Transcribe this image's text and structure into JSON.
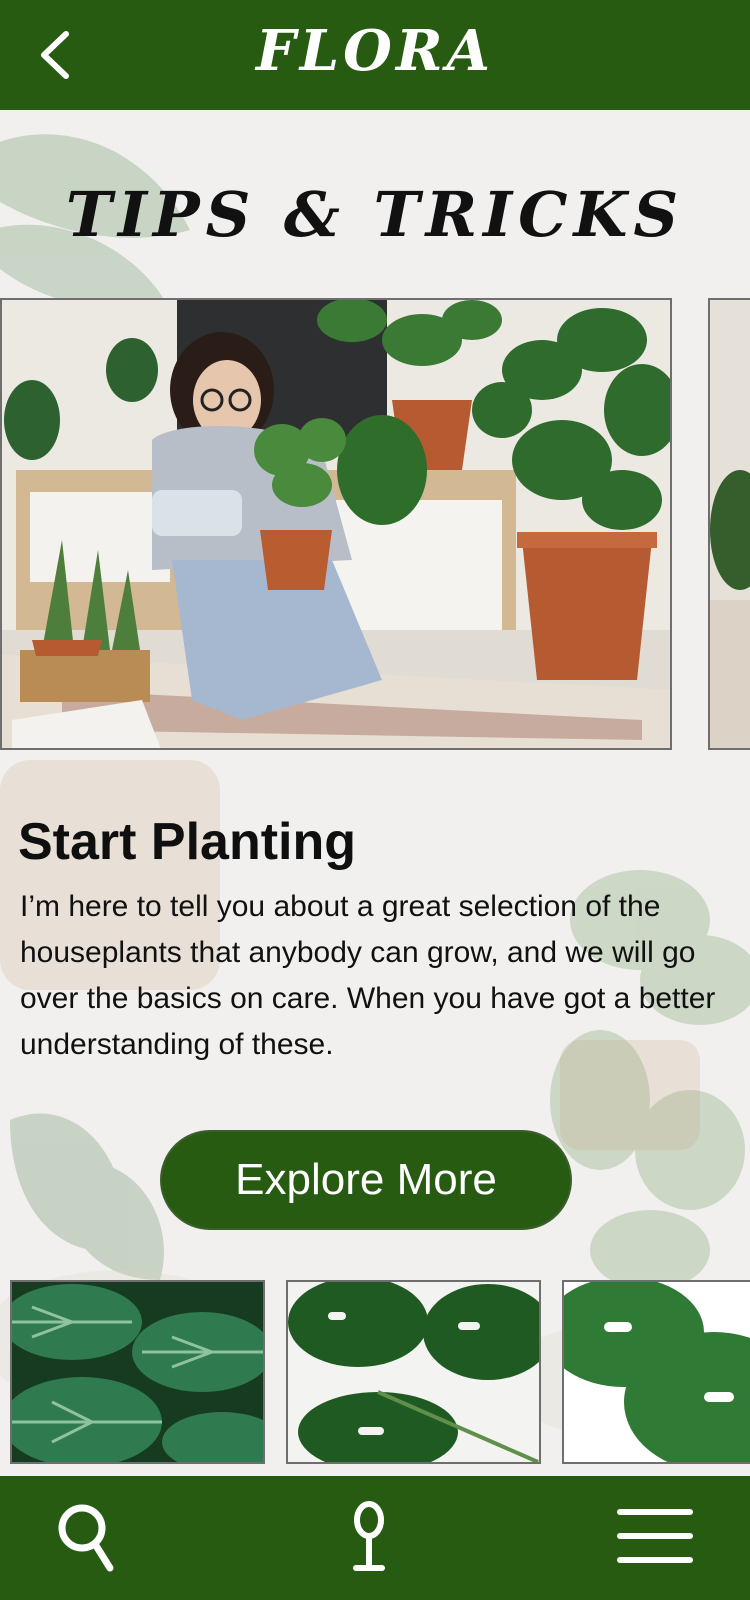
{
  "app": {
    "title": "FLORA"
  },
  "page": {
    "section_title": "TIPS  & TRICKS"
  },
  "article": {
    "title": "Start Planting",
    "body": "I’m here to tell you about a great selection of the houseplants that anybody can grow, and we will go over the basics on care. When you have got a better understanding of these.",
    "cta_label": "Explore More"
  },
  "icons": {
    "back": "chevron-left-icon",
    "search": "search-icon",
    "location": "location-pin-icon",
    "menu": "hamburger-menu-icon"
  },
  "colors": {
    "brand_green": "#275b12",
    "text": "#111111",
    "background": "#f2f1ef"
  }
}
